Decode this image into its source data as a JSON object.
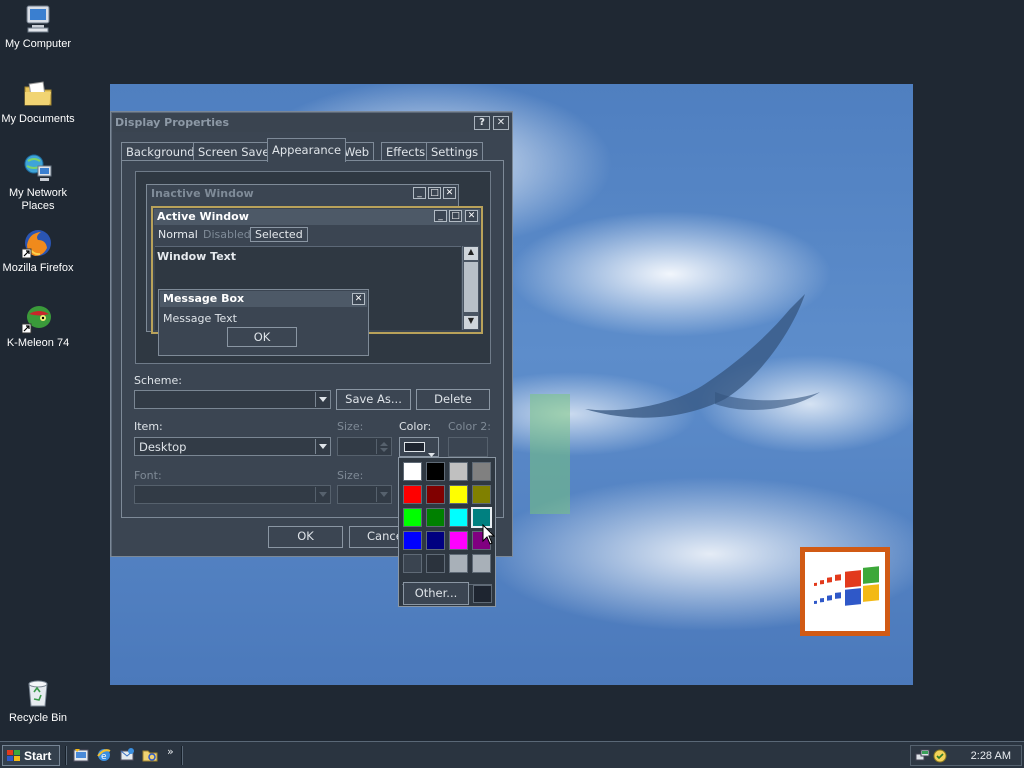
{
  "desktop": {
    "icons": [
      {
        "label": "My Computer"
      },
      {
        "label": "My Documents"
      },
      {
        "label": "My Network Places"
      },
      {
        "label": "Mozilla Firefox"
      },
      {
        "label": "K-Meleon 74"
      },
      {
        "label": "Recycle Bin"
      }
    ]
  },
  "dialog": {
    "title": "Display Properties",
    "help_glyph": "?",
    "close_glyph": "✕",
    "tabs": [
      {
        "label": "Background"
      },
      {
        "label": "Screen Saver"
      },
      {
        "label": "Appearance"
      },
      {
        "label": "Web"
      },
      {
        "label": "Effects"
      },
      {
        "label": "Settings"
      }
    ],
    "active_tab": "Appearance",
    "preview": {
      "inactive_title": "Inactive Window",
      "active_title": "Active Window",
      "menu": [
        "Normal",
        "Disabled",
        "Selected"
      ],
      "window_text": "Window Text",
      "msgbox_title": "Message Box",
      "msgbox_text": "Message Text",
      "msgbox_ok": "OK"
    },
    "scheme_label": "Scheme:",
    "scheme_value": "",
    "save_as_label": "Save As...",
    "delete_label": "Delete",
    "item_label": "Item:",
    "item_value": "Desktop",
    "size_label": "Size:",
    "color_label": "Color:",
    "color2_label": "Color 2:",
    "font_label": "Font:",
    "font_size_label": "Size:",
    "ok_label": "OK",
    "cancel_label": "Cancel"
  },
  "color_popup": {
    "colors": [
      "#ffffff",
      "#000000",
      "#c0c0c0",
      "#808080",
      "#ff0000",
      "#800000",
      "#ffff00",
      "#808000",
      "#00ff00",
      "#008000",
      "#00ffff",
      "#008080",
      "#0000ff",
      "#000080",
      "#ff00ff",
      "#800080",
      "#3a4450",
      "#2b333d",
      "#a8b0b8",
      "#a8b0b8"
    ],
    "selected_color": "#008080",
    "other_label": "Other...",
    "current_color": "#1e2530"
  },
  "taskbar": {
    "start_label": "Start",
    "quick_launch": [
      "show-desktop-icon",
      "ie-icon",
      "outlook-icon",
      "explorer-icon"
    ],
    "chevron": "»",
    "clock": "2:28 AM"
  }
}
